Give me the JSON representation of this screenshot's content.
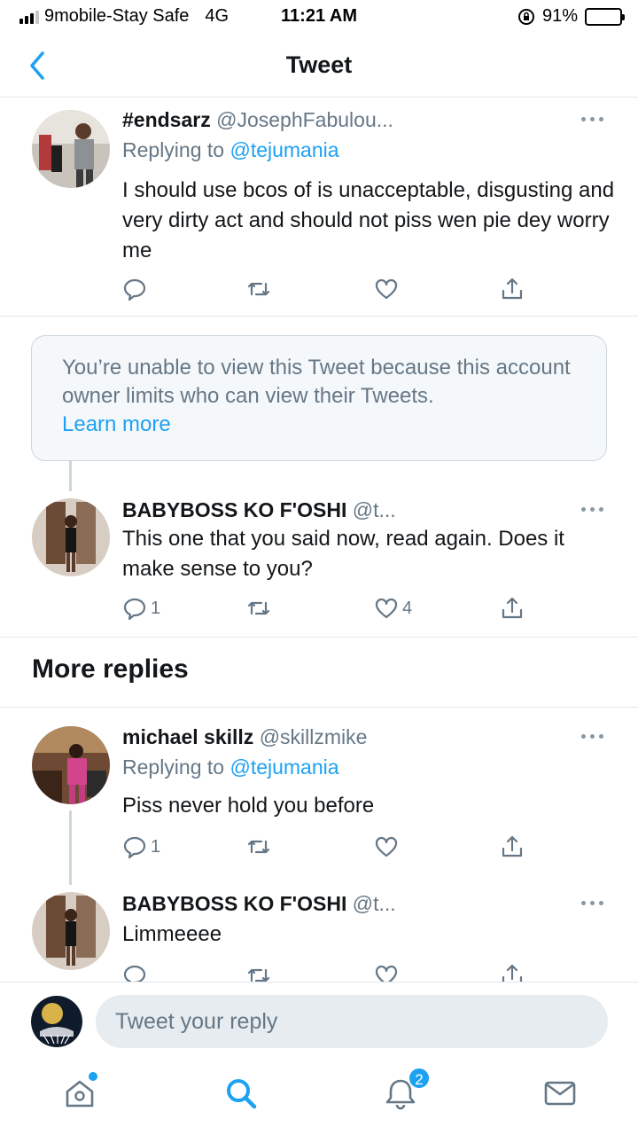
{
  "status_bar": {
    "carrier": "9mobile-Stay Safe",
    "network": "4G",
    "time": "11:21 AM",
    "battery_percent": "91%",
    "battery_level": 0.91
  },
  "header": {
    "title": "Tweet"
  },
  "tweets": [
    {
      "name": "#endsarz",
      "handle": "@JosephFabulou...",
      "replying_prefix": "Replying to ",
      "replying_to": "@tejumania",
      "text": "I should use bcos of is unacceptable, disgusting and very dirty act and should not piss wen pie dey worry me",
      "reply_count": "",
      "retweet_count": "",
      "like_count": ""
    },
    {
      "name": "BABYBOSS KO F'OSHI",
      "handle": "@t...",
      "text": "This one that you said now, read again. Does it make sense to you?",
      "reply_count": "1",
      "retweet_count": "",
      "like_count": "4"
    },
    {
      "name": "michael skillz",
      "handle": "@skillzmike",
      "replying_prefix": "Replying to ",
      "replying_to": "@tejumania",
      "text": "Piss never hold you before",
      "reply_count": "1",
      "retweet_count": "",
      "like_count": ""
    },
    {
      "name": "BABYBOSS KO F'OSHI",
      "handle": "@t...",
      "text": "Limmeeee",
      "reply_count": "",
      "retweet_count": "",
      "like_count": ""
    }
  ],
  "unavailable": {
    "message": "You’re unable to view this Tweet because this account owner limits who can view their Tweets.",
    "link": "Learn more"
  },
  "more_replies_title": "More replies",
  "composer": {
    "placeholder": "Tweet your reply"
  },
  "tabbar": {
    "notifications_badge": "2",
    "icons": [
      "home-icon",
      "search-icon",
      "notifications-bell-icon",
      "messages-envelope-icon"
    ]
  },
  "colors": {
    "accent": "#1da1f2",
    "secondary_text": "#657786",
    "divider": "#e1e8ed"
  }
}
